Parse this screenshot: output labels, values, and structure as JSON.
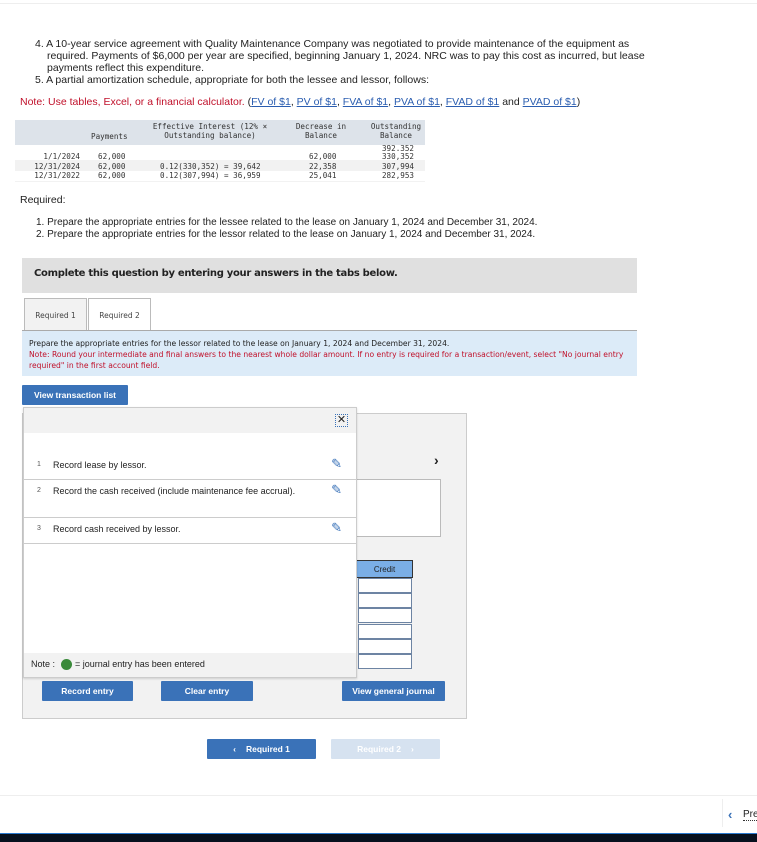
{
  "question": {
    "item4": "4. A 10-year service agreement with Quality Maintenance Company was negotiated to provide maintenance of the equipment as required. Payments of $6,000 per year are specified, beginning January 1, 2024. NRC was to pay this cost as incurred, but lease payments reflect this expenditure.",
    "item5": "5. A partial amortization schedule, appropriate for both the lessee and lessor, follows:",
    "note": "Note: Use tables, Excel, or a financial calculator.",
    "links": [
      "FV of $1",
      "PV of $1",
      "FVA of $1",
      "PVA of $1",
      "FVAD of $1",
      "PVAD of $1"
    ],
    "and": "and"
  },
  "schedule": {
    "headers": [
      "Payments",
      "Effective Interest (12% × Outstanding balance)",
      "Decrease in Balance",
      "Outstanding Balance"
    ],
    "initial_balance": "392,352",
    "rows": [
      {
        "date": "1/1/2024",
        "payment": "62,000",
        "interest": "",
        "decrease": "62,000",
        "balance": "330,352"
      },
      {
        "date": "12/31/2024",
        "payment": "62,000",
        "interest": "0.12(330,352) = 39,642",
        "decrease": "22,358",
        "balance": "307,994"
      },
      {
        "date": "12/31/2022",
        "payment": "62,000",
        "interest": "0.12(307,994) = 36,959",
        "decrease": "25,041",
        "balance": "282,953"
      }
    ]
  },
  "required": {
    "title": "Required:",
    "items": [
      "1. Prepare the appropriate entries for the lessee related to the lease on January 1, 2024 and December 31, 2024.",
      "2. Prepare the appropriate entries for the lessor related to the lease on January 1, 2024 and December 31, 2024."
    ]
  },
  "banner": "Complete this question by entering your answers in the tabs below.",
  "tabs": [
    "Required 1",
    "Required 2"
  ],
  "active_tab": "Required 2",
  "instructions": {
    "text": "Prepare the appropriate entries for the lessor related to the lease on January 1, 2024 and December 31, 2024.",
    "note": "Note: Round your intermediate and final answers to the nearest whole dollar amount. If no entry is required for a transaction/event, select \"No journal entry required\" in the first account field."
  },
  "view_transaction_list": "View transaction list",
  "transactions": [
    {
      "num": "1",
      "text": "Record lease by lessor."
    },
    {
      "num": "2",
      "text": "Record the cash received (include maintenance fee accrual)."
    },
    {
      "num": "3",
      "text": "Record cash received by lessor."
    }
  ],
  "popup_note": {
    "prefix": "Note :",
    "suffix": "= journal entry has been entered",
    "indicator_color": "#3a8a3a"
  },
  "journal": {
    "credit_header": "Credit"
  },
  "buttons": {
    "record": "Record entry",
    "clear": "Clear entry",
    "view_journal": "View general journal"
  },
  "nav": {
    "prev": "Required 1",
    "next": "Required 2"
  },
  "footer": {
    "prev": "Pre"
  },
  "colors": {
    "accent": "#3a72b8",
    "note_red": "#c0102a",
    "info_bg": "#dcebf8"
  }
}
